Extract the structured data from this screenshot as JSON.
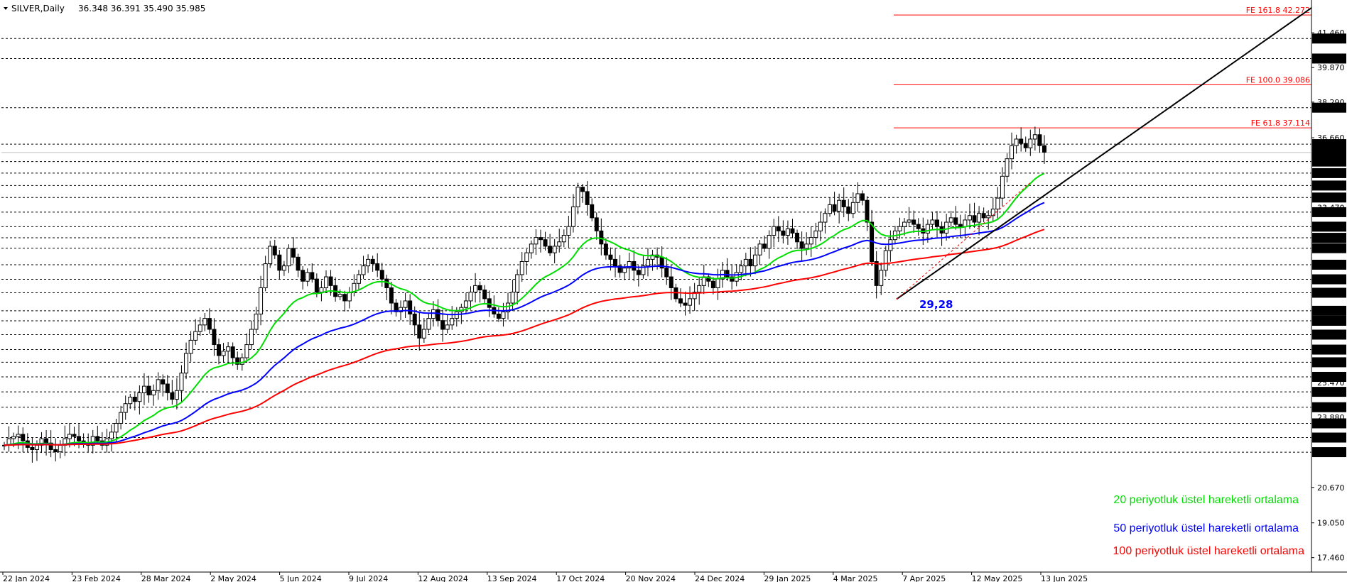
{
  "header": {
    "symbol": "SILVER,Daily",
    "ohlc": "36.348 36.391 35.490 35.985"
  },
  "chart_data": {
    "type": "candlestick",
    "instrument": "SILVER",
    "timeframe": "Daily",
    "ohlc_last": {
      "open": 36.348,
      "high": 36.391,
      "low": 35.49,
      "close": 35.985
    },
    "ylim": [
      16.8,
      42.7
    ],
    "x_ticks": [
      "22 Jan 2024",
      "23 Feb 2024",
      "28 Mar 2024",
      "2 May 2024",
      "5 Jun 2024",
      "9 Jul 2024",
      "12 Aug 2024",
      "13 Sep 2024",
      "17 Oct 2024",
      "20 Nov 2024",
      "24 Dec 2024",
      "29 Jan 2025",
      "4 Mar 2025",
      "7 Apr 2025",
      "12 May 2025",
      "13 Jun 2025"
    ],
    "axis_ticks": [
      "41.460",
      "39.870",
      "38.290",
      "36.660",
      "20.670",
      "19.050",
      "17.460"
    ],
    "level_labels": [
      "41.197",
      "40.283",
      "38.036",
      "36.369",
      "35.985",
      "35.571",
      "35.043",
      "34.475",
      "33.927",
      "33.258",
      "32.594",
      "32.085",
      "31.610",
      "30.855",
      "30.187",
      "29.573",
      "28.747",
      "28.290",
      "27.658",
      "26.973",
      "26.393",
      "25.726",
      "25.041",
      "24.338",
      "23.600",
      "22.950",
      "22.283"
    ],
    "minor_ticks": [
      "33.470",
      "25.470",
      "23.880"
    ],
    "fib_extensions": [
      {
        "label": "FE 161.8 42.272",
        "value": 42.272
      },
      {
        "label": "FE 100.0 39.086",
        "value": 39.086
      },
      {
        "label": "FE 61.8 37.114",
        "value": 37.114
      }
    ],
    "annotation": {
      "text": "29,28",
      "value": 29.28
    },
    "series": [
      {
        "name": "20 periyotluk üstel hareketli ortalama",
        "color": "#00dd00"
      },
      {
        "name": "50 periyotluk üstel hareketli ortalama",
        "color": "#0000ff"
      },
      {
        "name": "100 periyotluk üstel hareketli ortalama",
        "color": "#ff0000"
      }
    ],
    "closes": [
      22.6,
      22.9,
      23.0,
      23.1,
      22.8,
      22.5,
      22.4,
      22.6,
      22.9,
      22.7,
      22.4,
      22.3,
      22.6,
      22.9,
      23.1,
      23.0,
      22.8,
      22.7,
      22.6,
      23.0,
      22.8,
      22.6,
      22.9,
      23.2,
      23.6,
      24.1,
      24.5,
      24.8,
      24.6,
      25.0,
      25.3,
      24.9,
      25.1,
      25.6,
      25.4,
      25.0,
      24.7,
      25.1,
      25.9,
      26.8,
      27.4,
      27.8,
      28.1,
      28.4,
      27.9,
      27.2,
      26.7,
      26.9,
      27.1,
      26.6,
      26.3,
      26.6,
      27.2,
      27.9,
      28.6,
      29.8,
      30.9,
      31.7,
      31.3,
      30.6,
      30.8,
      31.6,
      31.2,
      30.6,
      30.1,
      30.5,
      30.2,
      29.6,
      29.8,
      30.3,
      29.9,
      29.4,
      29.5,
      29.2,
      29.6,
      30.0,
      30.4,
      30.8,
      31.1,
      30.9,
      30.6,
      30.2,
      29.8,
      29.1,
      28.7,
      28.9,
      29.2,
      28.6,
      28.1,
      27.5,
      27.9,
      28.4,
      28.8,
      28.3,
      27.9,
      28.1,
      28.4,
      28.7,
      28.9,
      29.2,
      29.6,
      29.9,
      29.7,
      29.3,
      28.9,
      28.6,
      28.4,
      28.7,
      29.1,
      29.6,
      30.4,
      31.0,
      31.4,
      31.8,
      32.1,
      32.0,
      31.7,
      31.4,
      31.7,
      31.9,
      32.2,
      32.6,
      33.5,
      34.4,
      34.2,
      33.6,
      33.0,
      32.4,
      31.8,
      31.3,
      31.1,
      30.8,
      30.5,
      30.7,
      31.0,
      30.6,
      30.4,
      30.8,
      31.1,
      31.3,
      31.2,
      30.7,
      30.3,
      29.8,
      29.3,
      29.1,
      29.0,
      29.3,
      29.6,
      29.9,
      30.3,
      30.1,
      29.8,
      30.2,
      30.6,
      30.3,
      30.1,
      30.5,
      30.8,
      31.1,
      30.8,
      31.3,
      31.8,
      31.6,
      32.2,
      32.6,
      32.4,
      32.2,
      32.5,
      32.3,
      31.9,
      31.6,
      31.8,
      32.1,
      32.4,
      32.8,
      33.2,
      33.6,
      33.3,
      33.8,
      33.5,
      33.2,
      33.7,
      34.1,
      33.8,
      32.8,
      31.0,
      29.9,
      30.6,
      31.5,
      32.0,
      32.4,
      32.6,
      32.8,
      32.9,
      32.7,
      32.5,
      32.3,
      32.7,
      32.9,
      32.6,
      32.3,
      32.8,
      33.0,
      32.7,
      32.6,
      32.9,
      33.1,
      32.8,
      33.2,
      33.0,
      33.1,
      33.4,
      33.9,
      34.9,
      35.7,
      36.3,
      36.6,
      36.4,
      36.2,
      36.6,
      36.8,
      36.3,
      36.0
    ]
  },
  "legend": {
    "ema20": "20 periyotluk üstel hareketli ortalama",
    "ema50": "50 periyotluk üstel hareketli ortalama",
    "ema100": "100 periyotluk üstel hareketli ortalama"
  }
}
